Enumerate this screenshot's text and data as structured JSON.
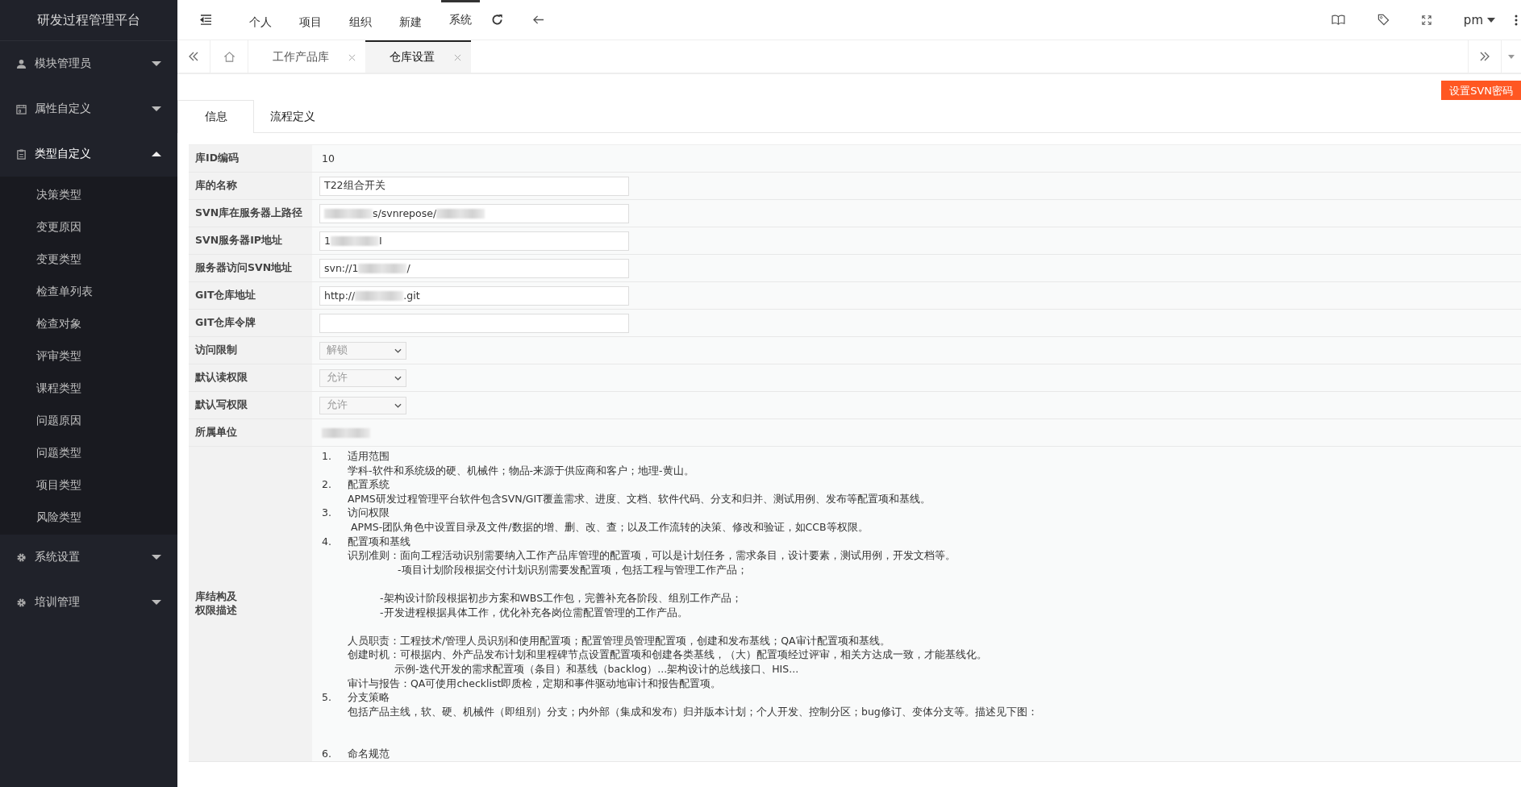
{
  "app": {
    "title": "研发过程管理平台"
  },
  "top_nav": [
    {
      "label": "个人",
      "selected": false
    },
    {
      "label": "项目",
      "selected": false
    },
    {
      "label": "组织",
      "selected": false
    },
    {
      "label": "新建",
      "selected": false
    },
    {
      "label": "系统",
      "selected": true
    }
  ],
  "user": {
    "name": "pm"
  },
  "sidebar": [
    {
      "label": "模块管理员",
      "expanded": false
    },
    {
      "label": "属性自定义",
      "expanded": false
    },
    {
      "label": "类型自定义",
      "expanded": true,
      "children": [
        {
          "label": "决策类型"
        },
        {
          "label": "变更原因"
        },
        {
          "label": "变更类型"
        },
        {
          "label": "检查单列表"
        },
        {
          "label": "检查对象"
        },
        {
          "label": "评审类型"
        },
        {
          "label": "课程类型"
        },
        {
          "label": "问题原因"
        },
        {
          "label": "问题类型"
        },
        {
          "label": "项目类型"
        },
        {
          "label": "风险类型"
        }
      ]
    },
    {
      "label": "系统设置",
      "expanded": false
    },
    {
      "label": "培训管理",
      "expanded": false
    }
  ],
  "page_tabs": [
    {
      "label": "工作产品库",
      "selected": false
    },
    {
      "label": "仓库设置",
      "selected": true
    }
  ],
  "action_button": "设置SVN密码",
  "info_tabs": [
    {
      "label": "信息",
      "selected": true
    },
    {
      "label": "流程定义",
      "selected": false
    }
  ],
  "form_rows": [
    {
      "label": "库ID编码",
      "kind": "text",
      "parts": [
        {
          "kind": "text",
          "text": "10"
        }
      ]
    },
    {
      "label": "库的名称",
      "kind": "input",
      "parts": [
        {
          "kind": "text",
          "text": "T22组合开关"
        }
      ]
    },
    {
      "label": "SVN库在服务器上路径",
      "kind": "input",
      "parts": [
        {
          "kind": "blur"
        },
        {
          "kind": "text",
          "text": "s/svnrepose/"
        },
        {
          "kind": "blur"
        }
      ]
    },
    {
      "label": "SVN服务器IP地址",
      "kind": "input",
      "parts": [
        {
          "kind": "text",
          "text": "1"
        },
        {
          "kind": "blur"
        },
        {
          "kind": "text",
          "text": "I"
        }
      ]
    },
    {
      "label": "服务器访问SVN地址",
      "kind": "input",
      "parts": [
        {
          "kind": "text",
          "text": "svn://1"
        },
        {
          "kind": "blur"
        },
        {
          "kind": "text",
          "text": "/"
        }
      ]
    },
    {
      "label": "GIT仓库地址",
      "kind": "input",
      "parts": [
        {
          "kind": "text",
          "text": "http://"
        },
        {
          "kind": "blur"
        },
        {
          "kind": "text",
          "text": ".git"
        }
      ]
    },
    {
      "label": "GIT仓库令牌",
      "kind": "input",
      "parts": []
    },
    {
      "label": "访问限制",
      "kind": "select",
      "parts": [
        {
          "kind": "text",
          "text": "解锁"
        }
      ]
    },
    {
      "label": "默认读权限",
      "kind": "select",
      "parts": [
        {
          "kind": "text",
          "text": "允许"
        }
      ]
    },
    {
      "label": "默认写权限",
      "kind": "select",
      "parts": [
        {
          "kind": "text",
          "text": "允许"
        }
      ]
    },
    {
      "label": "所属单位",
      "kind": "text",
      "parts": [
        {
          "kind": "blur"
        }
      ]
    }
  ],
  "description": {
    "label_lines": [
      "库结构及",
      "权限描述"
    ],
    "lines": [
      {
        "kind": "heading",
        "number": "1.",
        "text": "适用范围"
      },
      {
        "kind": "line",
        "text": "学科-软件和系统级的硬、机械件；物品-来源于供应商和客户；地理-黄山。"
      },
      {
        "kind": "heading",
        "number": "2.",
        "text": "配置系统"
      },
      {
        "kind": "line",
        "text": "APMS研发过程管理平台软件包含SVN/GIT覆盖需求、进度、文档、软件代码、分支和归并、测试用例、发布等配置项和基线。"
      },
      {
        "kind": "heading",
        "number": "3.",
        "text": "访问权限"
      },
      {
        "kind": "line",
        "text": " APMS-团队角色中设置目录及文件/数据的增、删、改、查；以及工作流转的决策、修改和验证，如CCB等权限。"
      },
      {
        "kind": "heading",
        "number": "4.",
        "text": "配置项和基线"
      },
      {
        "kind": "line",
        "text": "识别准则：面向工程活动识别需要纳入工作产品库管理的配置项，可以是计划任务，需求条目，设计要素，测试用例，开发文档等。"
      },
      {
        "kind": "deep",
        "text": "-项目计划阶段根据交付计划识别需要发配置项，包括工程与管理工作产品；"
      },
      {
        "kind": "gap"
      },
      {
        "kind": "mid",
        "text": "-架构设计阶段根据初步方案和WBS工作包，完善补充各阶段、组别工作产品；"
      },
      {
        "kind": "mid",
        "text": "-开发进程根据具体工作，优化补充各岗位需配置管理的工作产品。"
      },
      {
        "kind": "gap"
      },
      {
        "kind": "line",
        "text": "人员职责：工程技术/管理人员识别和使用配置项；配置管理员管理配置项，创建和发布基线；QA审计配置项和基线。"
      },
      {
        "kind": "line",
        "text": "创建时机：可根据内、外产品发布计划和里程碑节点设置配置项和创建各类基线，（大）配置项经过评审，相关方达成一致，才能基线化。"
      },
      {
        "kind": "deep2",
        "text": "示例-迭代开发的需求配置项（条目）和基线（backlog）...架构设计的总线接口、HIS..."
      },
      {
        "kind": "line",
        "text": "审计与报告：QA可使用checklist即质检，定期和事件驱动地审计和报告配置项。"
      },
      {
        "kind": "heading",
        "number": "5.",
        "text": "分支策略"
      },
      {
        "kind": "line",
        "text": "包括产品主线，软、硬、机械件（即组别）分支；内外部（集成和发布）归并版本计划；个人开发、控制分区；bug修订、变体分支等。描述见下图："
      },
      {
        "kind": "gap"
      },
      {
        "kind": "gap"
      },
      {
        "kind": "heading",
        "number": "6.",
        "text": "命名规范"
      }
    ]
  }
}
